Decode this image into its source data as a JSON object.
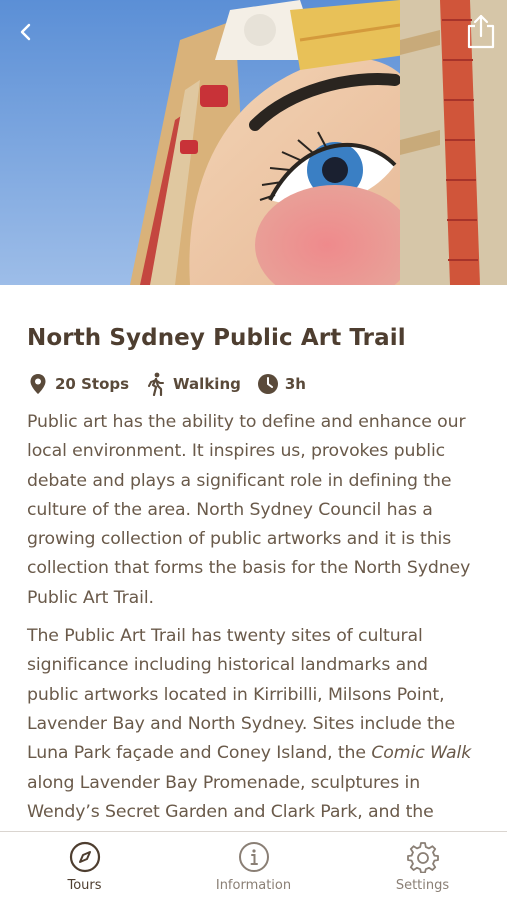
{
  "hero": {
    "back_icon": "chevron-left-icon",
    "share_icon": "share-icon"
  },
  "tour": {
    "title": "North Sydney Public Art Trail",
    "meta": [
      {
        "icon": "location-pin-icon",
        "text": "20 Stops"
      },
      {
        "icon": "walking-icon",
        "text": "Walking"
      },
      {
        "icon": "clock-icon",
        "text": "3h"
      }
    ],
    "paragraph1": "Public art has the ability to define and enhance our local environment. It inspires us, provokes public debate and plays a significant role in defining the culture of the area. North Sydney Council has a growing collection of public artworks and it is this collection that forms the basis for the North Sydney Public Art Trail.",
    "paragraph2_part1": "The Public Art Trail has twenty sites of cultural significance including historical landmarks and public artworks located in Kirribilli, Milsons Point, Lavender Bay and North Sydney. Sites include the Luna Park façade and Coney Island, the ",
    "paragraph2_italic": "Comic Walk",
    "paragraph2_part2": " along Lavender Bay Promenade, sculptures in Wendy’s Secret Garden and Clark Park, and the"
  },
  "tabbar": {
    "tabs": [
      {
        "label": "Tours",
        "icon": "compass-icon",
        "active": true
      },
      {
        "label": "Information",
        "icon": "info-icon",
        "active": false
      },
      {
        "label": "Settings",
        "icon": "gear-icon",
        "active": false
      }
    ]
  },
  "colors": {
    "text_primary": "#4e3e30",
    "text_body": "#6a5a4a",
    "tab_inactive": "#8a7f75"
  }
}
